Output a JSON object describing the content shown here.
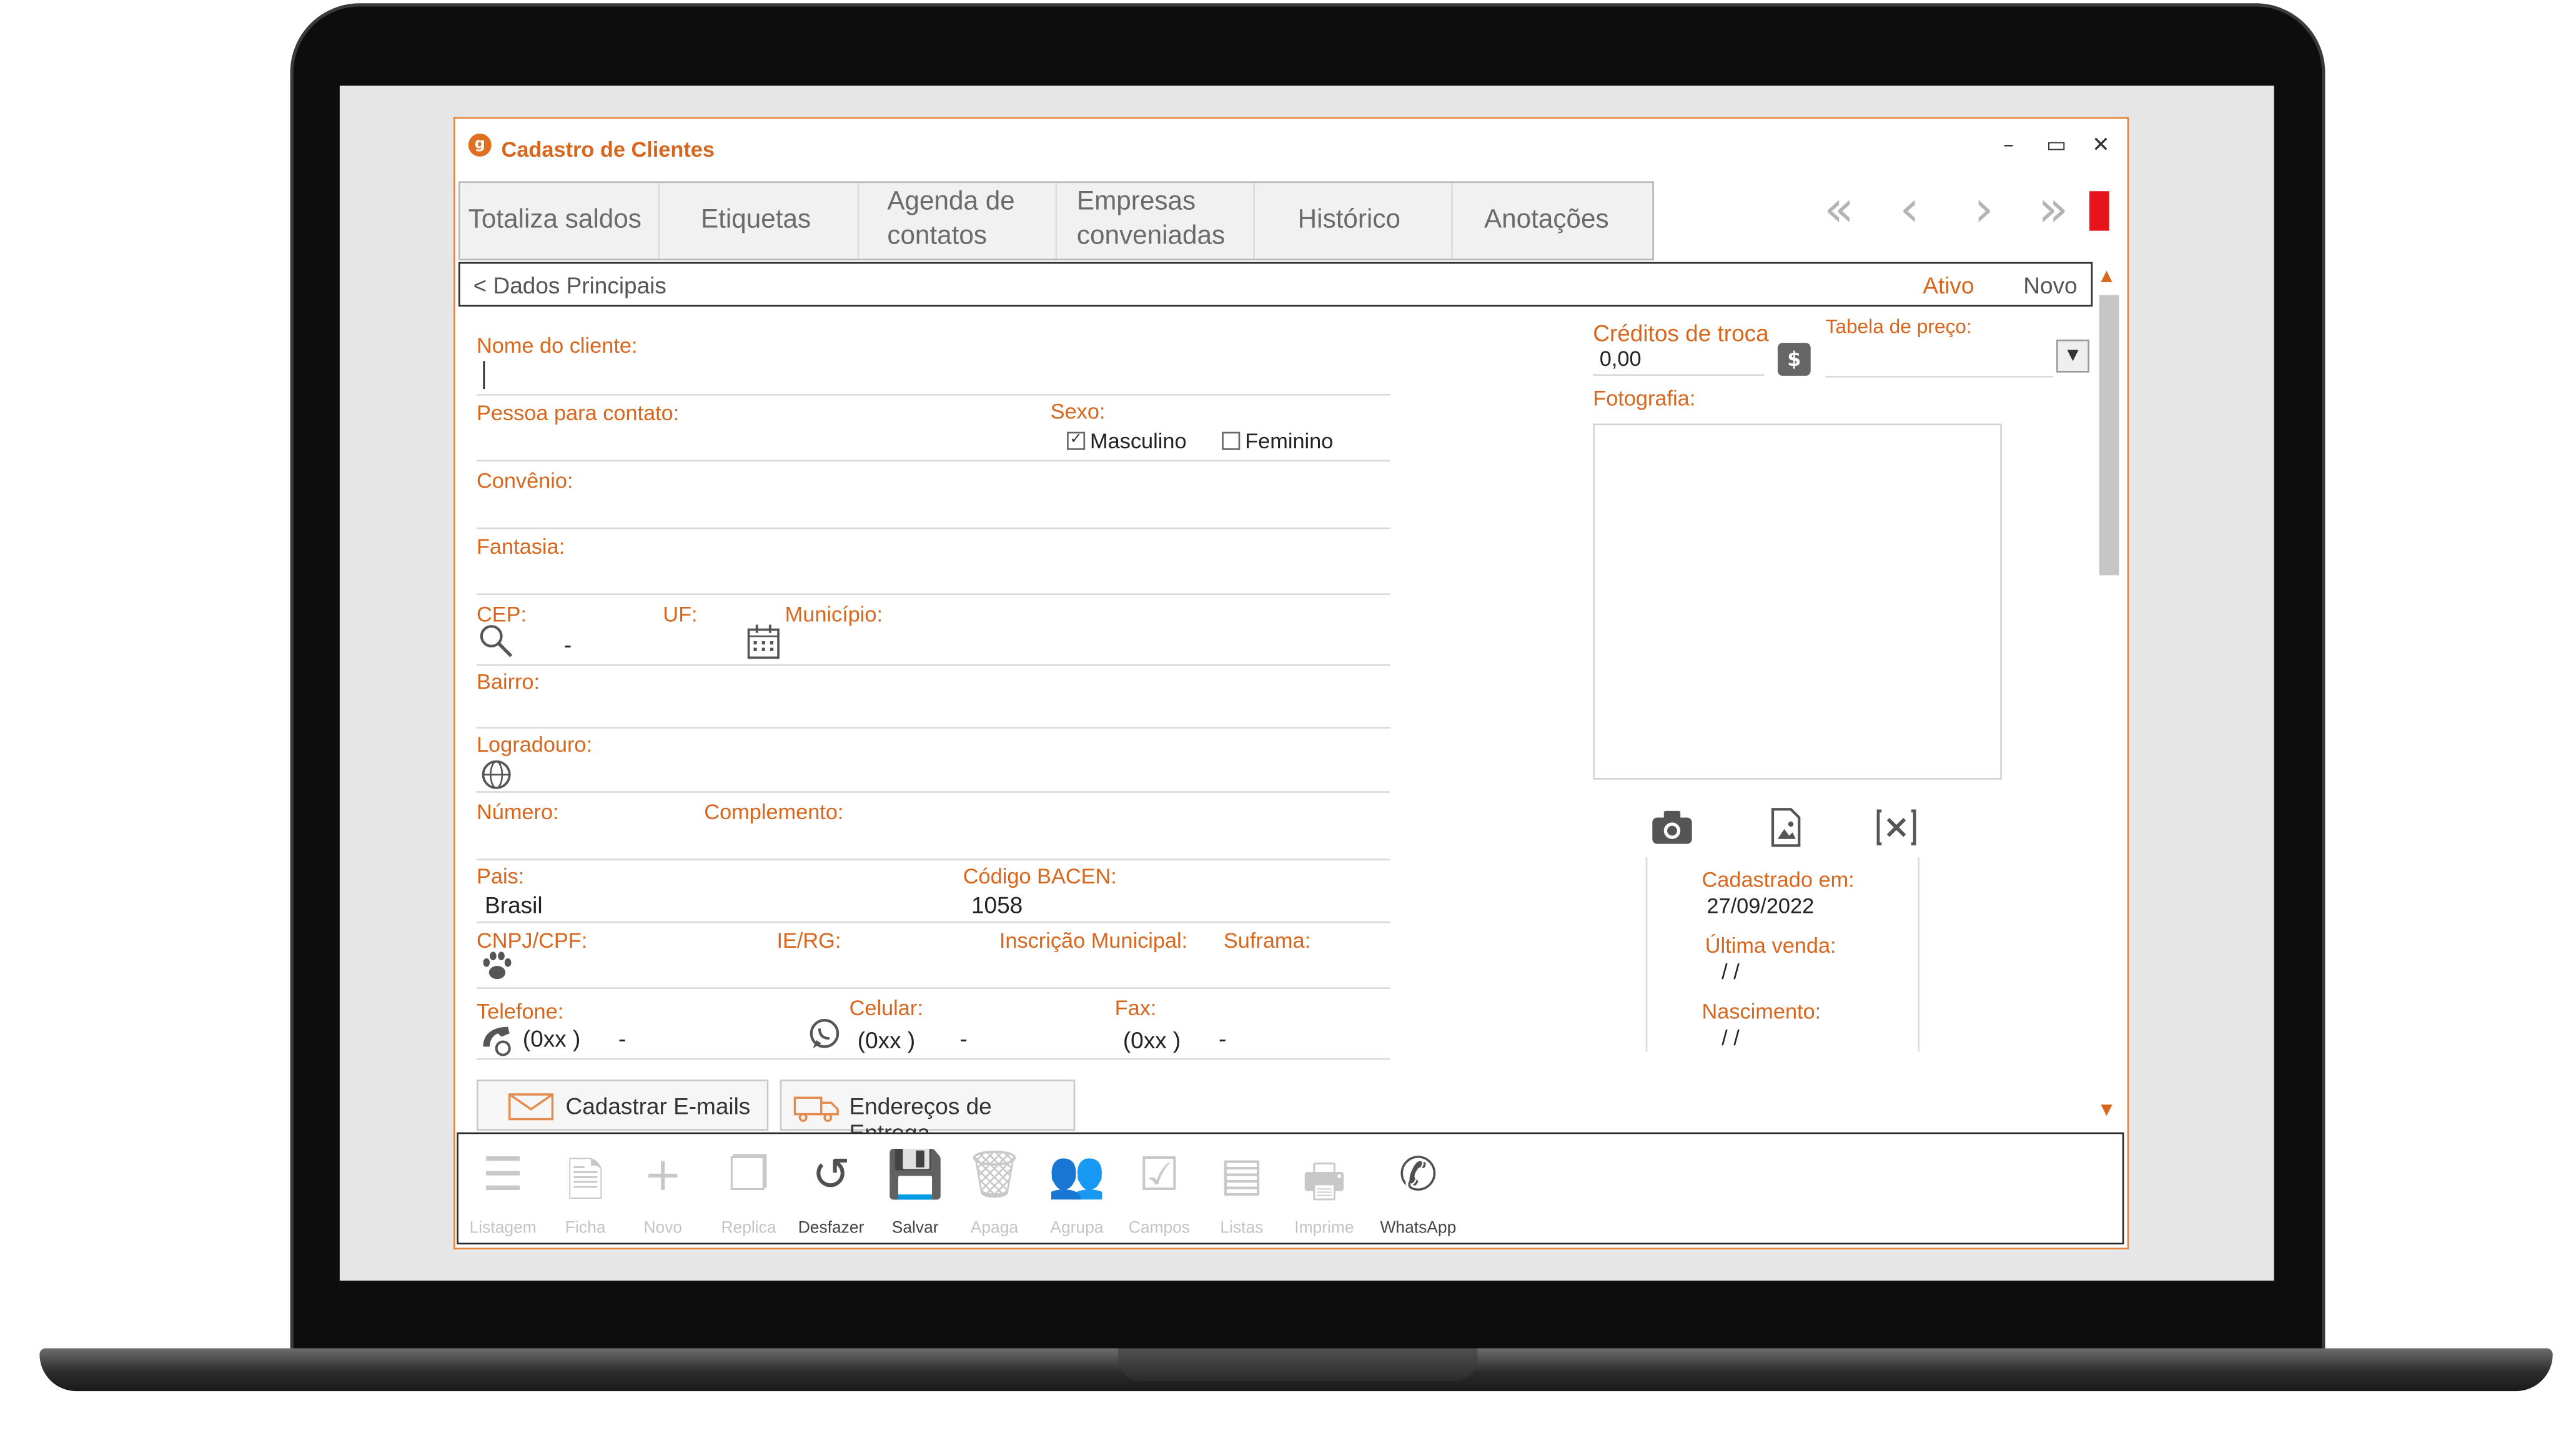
{
  "window": {
    "title": "Cadastro de Clientes",
    "minimize": "–",
    "maximize": "▭",
    "close": "✕"
  },
  "tabs": [
    {
      "line1": "Totaliza saldos",
      "line2": ""
    },
    {
      "line1": "Etiquetas",
      "line2": ""
    },
    {
      "line1": "Agenda de",
      "line2": "contatos"
    },
    {
      "line1": "Empresas",
      "line2": "conveniadas"
    },
    {
      "line1": "Histórico",
      "line2": ""
    },
    {
      "line1": "Anotações",
      "line2": ""
    }
  ],
  "nav": {
    "first": "«",
    "prev": "‹",
    "next": "›",
    "last": "»"
  },
  "section": {
    "title": "< Dados Principais",
    "status": "Ativo",
    "mode": "Novo"
  },
  "form": {
    "nome": {
      "label": "Nome do cliente:",
      "value": ""
    },
    "contato": {
      "label": "Pessoa para contato:",
      "value": ""
    },
    "sexo": {
      "label": "Sexo:",
      "masculino": "Masculino",
      "feminino": "Feminino",
      "selected": "Masculino"
    },
    "convenio": {
      "label": "Convênio:"
    },
    "fantasia": {
      "label": "Fantasia:"
    },
    "cep": {
      "label": "CEP:",
      "value": "-"
    },
    "uf": {
      "label": "UF:"
    },
    "municipio": {
      "label": "Município:"
    },
    "bairro": {
      "label": "Bairro:"
    },
    "logradouro": {
      "label": "Logradouro:"
    },
    "numero": {
      "label": "Número:"
    },
    "complemento": {
      "label": "Complemento:"
    },
    "pais": {
      "label": "Pais:",
      "value": "Brasil"
    },
    "bacen": {
      "label": "Código BACEN:",
      "value": "1058"
    },
    "cnpj": {
      "label": "CNPJ/CPF:"
    },
    "ie": {
      "label": "IE/RG:"
    },
    "inscricao": {
      "label": "Inscrição Municipal:"
    },
    "suframa": {
      "label": "Suframa:"
    },
    "telefone": {
      "label": "Telefone:",
      "ddd": "(0xx  )",
      "num": "-"
    },
    "celular": {
      "label": "Celular:",
      "ddd": "(0xx  )",
      "num": "-"
    },
    "fax": {
      "label": "Fax:",
      "ddd": "(0xx  )",
      "num": "-"
    }
  },
  "side": {
    "creditos": {
      "label": "Créditos de troca",
      "value": "0,00",
      "btn": "$"
    },
    "tabela": {
      "label": "Tabela de preço:"
    },
    "fotografia": {
      "label": "Fotografia:"
    },
    "cadastrado": {
      "label": "Cadastrado em:",
      "value": "27/09/2022"
    },
    "ultima": {
      "label": "Última venda:",
      "value": "/ /"
    },
    "nascimento": {
      "label": "Nascimento:",
      "value": "/ /"
    }
  },
  "buttons": {
    "emails": "Cadastrar E-mails",
    "entrega": "Endereços de Entrega"
  },
  "toolbar": [
    {
      "label": "Listagem",
      "glyph": "☰",
      "enabled": false
    },
    {
      "label": "Ficha",
      "glyph": "🗎",
      "enabled": false
    },
    {
      "label": "Novo",
      "glyph": "+",
      "enabled": false
    },
    {
      "label": "Replica",
      "glyph": "❐",
      "enabled": false
    },
    {
      "label": "Desfazer",
      "glyph": "↺",
      "enabled": true
    },
    {
      "label": "Salvar",
      "glyph": "💾",
      "enabled": true
    },
    {
      "label": "Apaga",
      "glyph": "🗑",
      "enabled": false
    },
    {
      "label": "Agrupa",
      "glyph": "👥",
      "enabled": false
    },
    {
      "label": "Campos",
      "glyph": "☑",
      "enabled": false
    },
    {
      "label": "Listas",
      "glyph": "▤",
      "enabled": false
    },
    {
      "label": "Imprime",
      "glyph": "🖶",
      "enabled": false
    },
    {
      "label": "WhatsApp",
      "glyph": "✆",
      "enabled": true
    }
  ]
}
